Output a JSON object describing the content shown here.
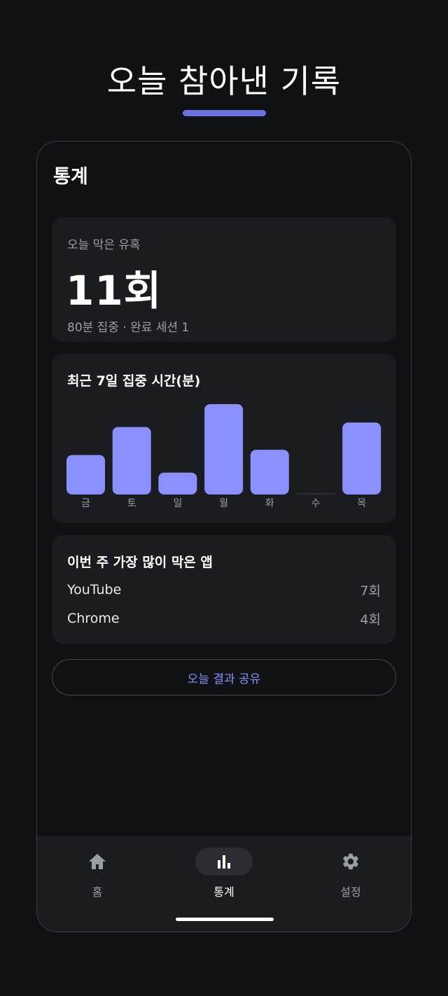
{
  "header": {
    "title": "오늘 참아낸 기록",
    "accent_color": "#6A72E0"
  },
  "screen": {
    "title": "통계"
  },
  "blocked_card": {
    "label": "오늘 막은 유혹",
    "count": "11회",
    "summary": "80분 집중 · 완료 세션 1"
  },
  "chart_card": {
    "title": "최근 7일 집중 시간(분)",
    "chart_data": {
      "type": "bar",
      "categories": [
        "금",
        "토",
        "일",
        "월",
        "화",
        "수",
        "목"
      ],
      "values": [
        45,
        77,
        25,
        103,
        51,
        0,
        82
      ],
      "ylim": [
        0,
        103
      ],
      "bar_color": "#8A91FF",
      "baseline_color": "#2f3035",
      "grid": false
    }
  },
  "apps_card": {
    "title": "이번 주 가장 많이 막은 앱",
    "apps": [
      {
        "name": "YouTube",
        "count": "7회"
      },
      {
        "name": "Chrome",
        "count": "4회"
      }
    ]
  },
  "share_button": {
    "label": "오늘 결과 공유",
    "color": "#8A91FF"
  },
  "nav": {
    "items": [
      {
        "label": "홈",
        "icon": "home-icon",
        "active": false
      },
      {
        "label": "통계",
        "icon": "bar-chart-icon",
        "active": true
      },
      {
        "label": "설정",
        "icon": "gear-icon",
        "active": false
      }
    ]
  }
}
